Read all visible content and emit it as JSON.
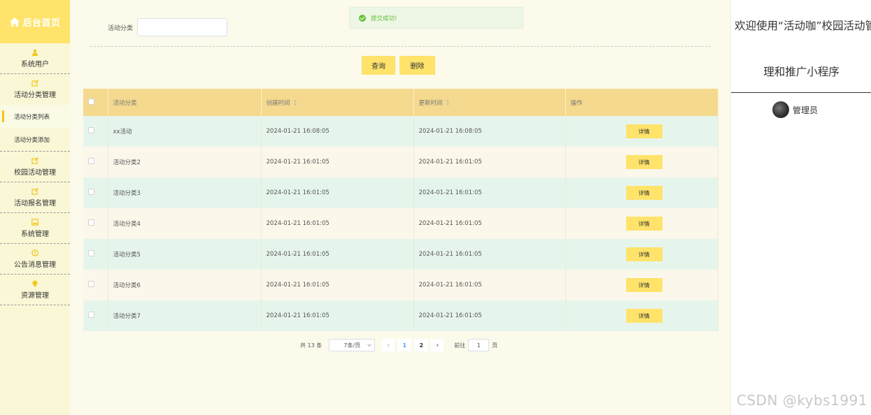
{
  "sidebar": {
    "logo_text": "后台首页",
    "menu": [
      {
        "label": "系统用户",
        "icon": "user-icon"
      },
      {
        "label": "活动分类管理",
        "icon": "edit-icon",
        "children": [
          "活动分类列表",
          "活动分类添加"
        ]
      },
      {
        "label": "校园活动管理",
        "icon": "edit-icon"
      },
      {
        "label": "活动报名管理",
        "icon": "edit-icon"
      },
      {
        "label": "系统管理",
        "icon": "image-icon"
      },
      {
        "label": "公告消息管理",
        "icon": "info-icon"
      },
      {
        "label": "资源管理",
        "icon": "bulb-icon"
      }
    ],
    "accent_color": "#ffe36a"
  },
  "toast": {
    "text": "提交成功!"
  },
  "search": {
    "label": "活动分类",
    "value": ""
  },
  "buttons": {
    "query": "查询",
    "delete": "删除"
  },
  "table": {
    "headers": [
      "活动分类",
      "创建时间",
      "更新时间",
      "操作"
    ],
    "rows": [
      {
        "name": "xx活动",
        "created": "2024-01-21 16:08:05",
        "updated": "2024-01-21 16:08:05",
        "action": "详情"
      },
      {
        "name": "活动分类2",
        "created": "2024-01-21 16:01:05",
        "updated": "2024-01-21 16:01:05",
        "action": "详情"
      },
      {
        "name": "活动分类3",
        "created": "2024-01-21 16:01:05",
        "updated": "2024-01-21 16:01:05",
        "action": "详情"
      },
      {
        "name": "活动分类4",
        "created": "2024-01-21 16:01:05",
        "updated": "2024-01-21 16:01:05",
        "action": "详情"
      },
      {
        "name": "活动分类5",
        "created": "2024-01-21 16:01:05",
        "updated": "2024-01-21 16:01:05",
        "action": "详情"
      },
      {
        "name": "活动分类6",
        "created": "2024-01-21 16:01:05",
        "updated": "2024-01-21 16:01:05",
        "action": "详情"
      },
      {
        "name": "活动分类7",
        "created": "2024-01-21 16:01:05",
        "updated": "2024-01-21 16:01:05",
        "action": "详情"
      }
    ]
  },
  "pagination": {
    "total": "共 13 条",
    "page_size": "7条/页",
    "pages": [
      "1",
      "2"
    ],
    "current": "1",
    "goto_prefix": "前往",
    "goto_value": "1",
    "goto_suffix": "页"
  },
  "right": {
    "welcome_line1": "欢迎使用“活动咖”校园活动管",
    "welcome_line2": "理和推广小程序",
    "username": "管理员"
  },
  "watermark": "CSDN @kybs1991"
}
